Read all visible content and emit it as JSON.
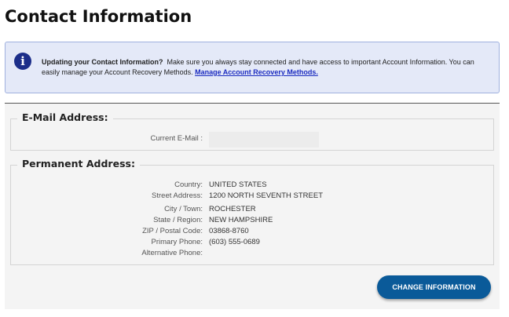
{
  "page": {
    "title": "Contact Information"
  },
  "notice": {
    "icon": "info-icon",
    "icon_glyph": "i",
    "heading": "Updating your Contact Information?",
    "body": "Make sure you always stay connected and have access to important Account Information. You can easily manage your Account Recovery Methods.",
    "link_label": "Manage Account Recovery Methods."
  },
  "email_section": {
    "legend": "E-Mail Address:",
    "current_email_label": "Current E-Mail :",
    "current_email_value": ""
  },
  "address_section": {
    "legend": "Permanent Address:",
    "fields": [
      {
        "label": "Country:",
        "value": "UNITED STATES"
      },
      {
        "label": "Street Address:",
        "value": "1200 NORTH SEVENTH STREET"
      },
      {
        "label": "City / Town:",
        "value": "ROCHESTER"
      },
      {
        "label": "State / Region:",
        "value": "NEW HAMPSHIRE"
      },
      {
        "label": "ZIP / Postal Code:",
        "value": "03868-8760"
      },
      {
        "label": "Primary Phone:",
        "value": "(603) 555-0689"
      },
      {
        "label": "Alternative Phone:",
        "value": ""
      }
    ]
  },
  "actions": {
    "change_label": "CHANGE INFORMATION"
  },
  "colors": {
    "accent": "#0a5a99",
    "notice_bg": "#e4e9f8",
    "link": "#1c2cc0",
    "panel_bg": "#f4f4f4"
  }
}
